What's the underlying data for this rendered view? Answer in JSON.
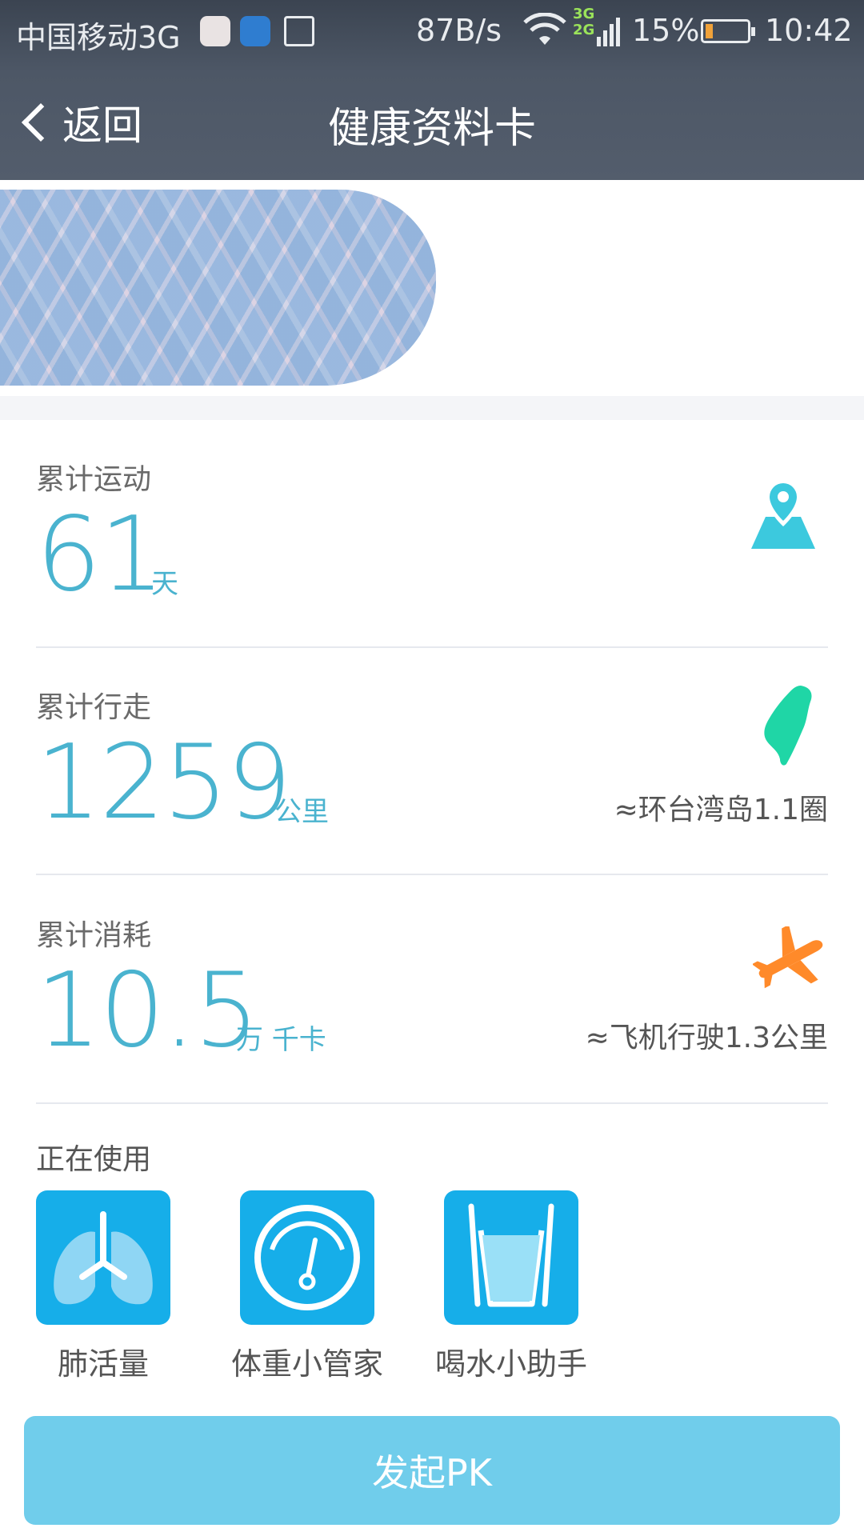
{
  "status_bar": {
    "carrier": "中国移动3G",
    "speed": "87B/s",
    "network_top": "3G",
    "network_bottom": "2G",
    "battery": "15%",
    "time": "10:42"
  },
  "nav": {
    "back_label": "返回",
    "title": "健康资料卡"
  },
  "stats": [
    {
      "label": "累计运动",
      "value": "61",
      "unit": "天",
      "note": "",
      "icon": "location-pin-icon",
      "icon_color": "#3cc9de"
    },
    {
      "label": "累计行走",
      "value": "1259",
      "unit": "公里",
      "note": "≈环台湾岛1.1圈",
      "icon": "taiwan-island-icon",
      "icon_color": "#1fd6a6"
    },
    {
      "label": "累计消耗",
      "value": "10.5",
      "unit": "万 千卡",
      "note": "≈飞机行驶1.3公里",
      "icon": "airplane-icon",
      "icon_color": "#ff8a2a"
    }
  ],
  "in_use": {
    "label": "正在使用",
    "tools": [
      {
        "name": "肺活量",
        "icon": "lungs-icon"
      },
      {
        "name": "体重小管家",
        "icon": "scale-gauge-icon"
      },
      {
        "name": "喝水小助手",
        "icon": "water-glass-icon"
      }
    ]
  },
  "pk_button": "发起PK",
  "colors": {
    "accent": "#4ab3cf",
    "tile": "#16aee9",
    "button": "#70cdeb",
    "header": "#4d5766"
  }
}
